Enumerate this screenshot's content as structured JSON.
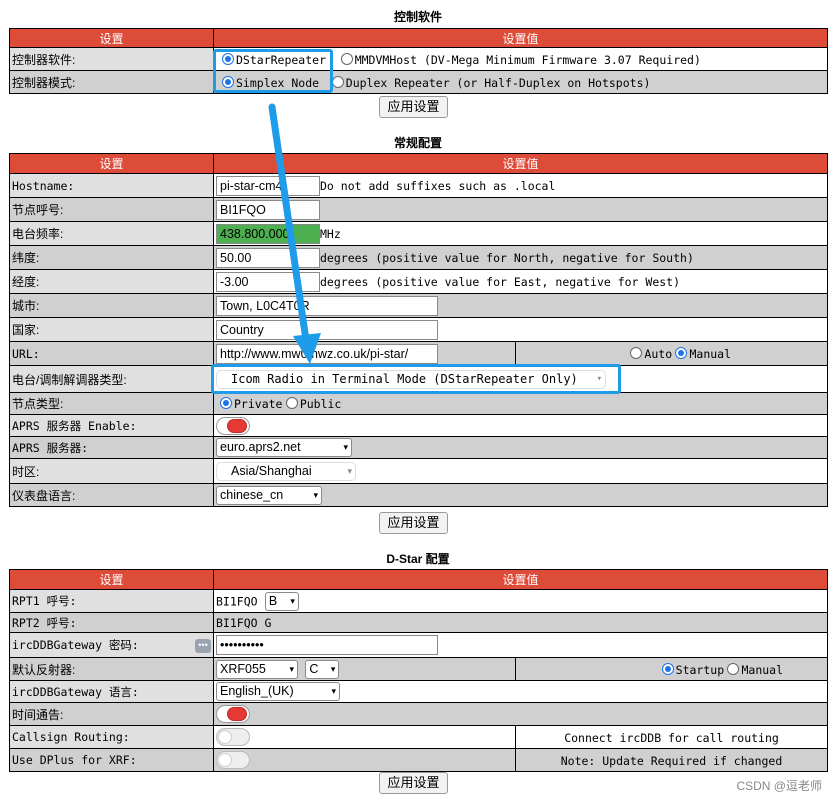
{
  "sections": {
    "control": {
      "title": "控制软件",
      "col_setting": "设置",
      "col_value": "设置值",
      "controller_software_label": "控制器软件:",
      "opt_dstar": "DStarRepeater",
      "opt_mmdvm": "MMDVMHost (DV-Mega Minimum Firmware 3.07 Required)",
      "controller_mode_label": "控制器模式:",
      "opt_simplex": "Simplex Node",
      "opt_duplex": "Duplex Repeater (or Half-Duplex on Hotspots)",
      "apply": "应用设置"
    },
    "general": {
      "title": "常规配置",
      "col_setting": "设置",
      "col_value": "设置值",
      "hostname_label": "Hostname:",
      "hostname_value": "pi-star-cm4",
      "hostname_note": "Do not add suffixes such as .local",
      "callsign_label": "节点呼号:",
      "callsign_value": "BI1FQO",
      "freq_label": "电台频率:",
      "freq_value": "438.800.000",
      "freq_unit": "MHz",
      "lat_label": "纬度:",
      "lat_value": "50.00",
      "lat_note": "degrees (positive value for North, negative for South)",
      "lon_label": "经度:",
      "lon_value": "-3.00",
      "lon_note": "degrees (positive value for East, negative for West)",
      "city_label": "城市:",
      "city_value": "Town, L0C4T0R",
      "country_label": "国家:",
      "country_value": "Country",
      "url_label": "URL:",
      "url_value": "http://www.mw0mwz.co.uk/pi-star/",
      "url_auto": "Auto",
      "url_manual": "Manual",
      "radio_type_label": "电台/调制解调器类型:",
      "radio_type_value": "Icom Radio in Terminal Mode (DStarRepeater Only)",
      "node_type_label": "节点类型:",
      "node_private": "Private",
      "node_public": "Public",
      "aprs_enable_label": "APRS 服务器 Enable:",
      "aprs_server_label": "APRS 服务器:",
      "aprs_server_value": "euro.aprs2.net",
      "timezone_label": "时区:",
      "timezone_value": "Asia/Shanghai",
      "dash_lang_label": "仪表盘语言:",
      "dash_lang_value": "chinese_cn",
      "apply": "应用设置"
    },
    "dstar": {
      "title": "D-Star 配置",
      "col_setting": "设置",
      "col_value": "设置值",
      "rpt1_label": "RPT1 呼号:",
      "rpt1_value": "BI1FQO",
      "rpt1_suffix": "B",
      "rpt2_label": "RPT2 呼号:",
      "rpt2_value": "BI1FQO G",
      "ircpwd_label": "ircDDBGateway 密码:",
      "ircpwd_value": "••••••••••",
      "reflector_label": "默认反射器:",
      "reflector_value": "XRF055",
      "reflector_module": "C",
      "reflector_startup": "Startup",
      "reflector_manual": "Manual",
      "irclang_label": "ircDDBGateway 语言:",
      "irclang_value": "English_(UK)",
      "time_ann_label": "时间通告:",
      "callsign_routing_label": "Callsign Routing:",
      "callsign_routing_note": "Connect ircDDB for call routing",
      "dplus_label": "Use DPlus for XRF:",
      "dplus_note": "Note: Update Required if changed",
      "apply": "应用设置"
    }
  },
  "watermark": "CSDN @逗老师",
  "colors": {
    "header_red": "#dd4b39",
    "highlight_blue": "#1e9be9",
    "freq_green": "#4caf50",
    "toggle_red": "#e53935"
  },
  "state": {
    "controller_software": "DStarRepeater",
    "controller_mode": "Simplex Node",
    "url_mode": "Manual",
    "node_type": "Private",
    "aprs_enable": true,
    "time_announce": true,
    "callsign_routing": false,
    "dplus_for_xrf": false,
    "reflector_on": "Startup"
  }
}
